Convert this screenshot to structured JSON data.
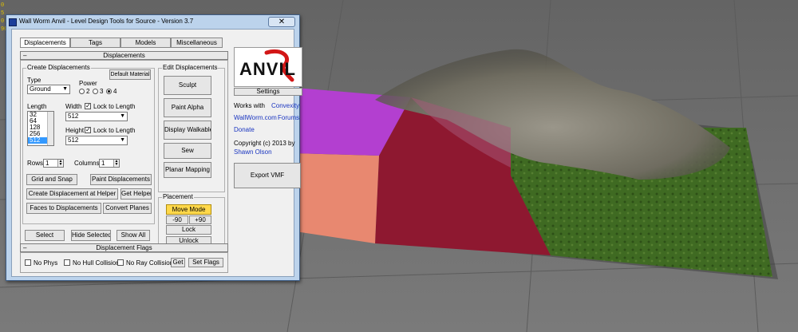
{
  "viewport": {
    "label_lines": [
      "0",
      "5",
      "0",
      "90"
    ],
    "colors": {
      "background": "#6e6e6e",
      "magenta": "#b33fd0",
      "salmon": "#e88870",
      "red": "#8e1830",
      "grass": "#3f6a22",
      "rock": "#8a8a80"
    }
  },
  "dialog": {
    "title": "Wall Worm Anvil - Level Design Tools for Source - Version 3.7",
    "close_glyph": "✕",
    "tabs": [
      "Displacements",
      "Tags",
      "Models",
      "Miscellaneous"
    ],
    "rollout_displacements": "Displacements",
    "rollout_flags": "Displacement Flags",
    "rollout_min_glyph": "–"
  },
  "create": {
    "title": "Create Displacements",
    "type_label": "Type",
    "type_value": "Ground",
    "power_label": "Power",
    "power_options": [
      "2",
      "3",
      "4"
    ],
    "default_material": "Default Material",
    "length_label": "Length",
    "length_items": [
      "32",
      "64",
      "128",
      "256",
      "512"
    ],
    "width_label": "Width",
    "width_value": "512",
    "height_label": "Height",
    "height_value": "512",
    "lock_to_length": "Lock to Length",
    "rows_label": "Rows",
    "rows_value": "1",
    "columns_label": "Columns",
    "columns_value": "1",
    "grid_and_snap": "Grid and Snap",
    "paint_displacements": "Paint Displacements",
    "create_at_helper": "Create Displacement at Helper",
    "get_helper": "Get Helper",
    "faces_to_displacements": "Faces to Displacements",
    "convert_planes": "Convert Planes",
    "select": "Select",
    "hide_selected": "Hide Selected",
    "show_all": "Show All"
  },
  "edit": {
    "title": "Edit Displacements",
    "sculpt": "Sculpt",
    "paint_alpha": "Paint Alpha",
    "display_walkable": "Display Walkable",
    "sew": "Sew",
    "planar_mapping": "Planar Mapping"
  },
  "placement": {
    "title": "Placement",
    "move_mode": "Move Mode",
    "minus90": "-90",
    "plus90": "+90",
    "lock": "Lock",
    "unlock": "Unlock"
  },
  "side": {
    "logo": "ANVIL",
    "settings": "Settings",
    "works_with": "Works with",
    "convexity": "Convexity",
    "wallworm": "WallWorm.com",
    "forums": "Forums",
    "donate": "Donate",
    "copyright": "Copyright (c) 2013 by",
    "author": "Shawn Olson",
    "export_vmf": "Export VMF"
  },
  "flags": {
    "no_phys": "No Phys",
    "no_hull": "No Hull Collision",
    "no_ray": "No Ray Collision",
    "get": "Get",
    "set_flags": "Set Flags"
  }
}
